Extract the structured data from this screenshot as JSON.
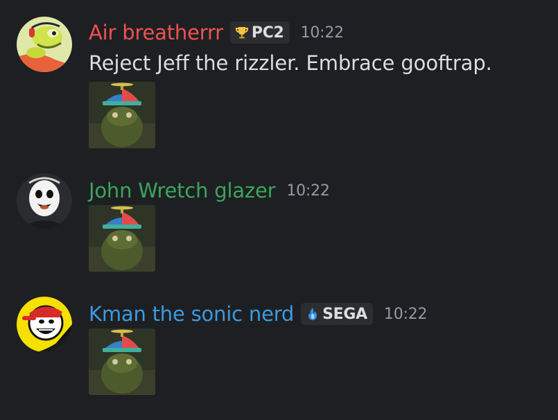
{
  "messages": [
    {
      "author": "Air breatherrr",
      "author_color": "#f0524f",
      "tag": {
        "icon": "trophy-icon",
        "label": "PC2"
      },
      "time": "10:22",
      "text": "Reject Jeff the rizzler. Embrace gooftrap.",
      "attachment": "propeller-cap-frog-image"
    },
    {
      "author": "John Wretch glazer",
      "author_color": "#3ba55c",
      "time": "10:22",
      "attachment": "propeller-cap-frog-image"
    },
    {
      "author": "Kman the sonic nerd",
      "author_color": "#3b9ae1",
      "tag": {
        "icon": "blue-flame-icon",
        "label": "SEGA"
      },
      "time": "10:22",
      "attachment": "propeller-cap-frog-image"
    }
  ]
}
